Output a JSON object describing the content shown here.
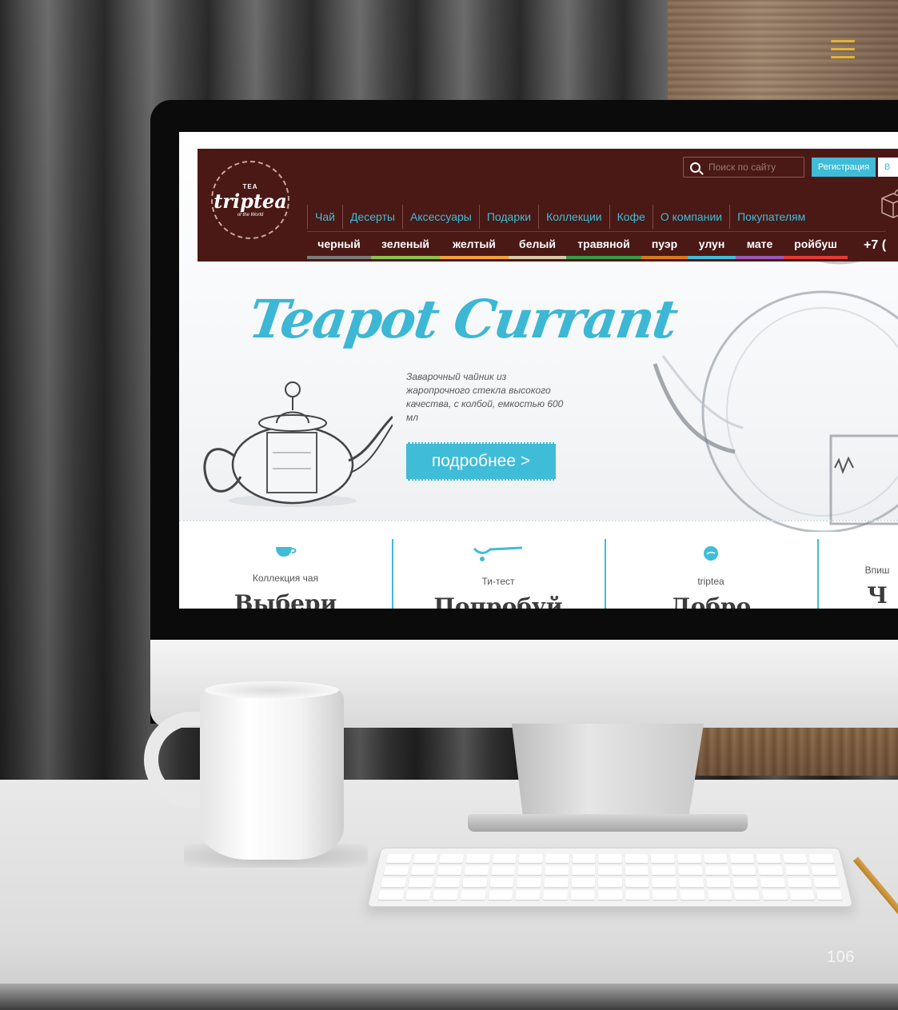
{
  "slide": {
    "page_number": "106",
    "menu_icon": "hamburger-menu-icon"
  },
  "site": {
    "logo": {
      "top": "TEA",
      "name": "triptea",
      "sub": "of the World"
    },
    "search": {
      "placeholder": "Поиск по сайту"
    },
    "register_label": "Регистрация",
    "login_label": "В",
    "main_nav": [
      "Чай",
      "Десерты",
      "Аксессуары",
      "Подарки",
      "Коллекции",
      "Кофе",
      "О компании",
      "Покупателям"
    ],
    "tea_nav": [
      {
        "label": "черный",
        "color": "#7a7a7a"
      },
      {
        "label": "зеленый",
        "color": "#8bc34a"
      },
      {
        "label": "желтый",
        "color": "#f2a23a"
      },
      {
        "label": "белый",
        "color": "#d8c9a8"
      },
      {
        "label": "травяной",
        "color": "#3a9a4a"
      },
      {
        "label": "пуэр",
        "color": "#d97a1a"
      },
      {
        "label": "улун",
        "color": "#3fbcd8"
      },
      {
        "label": "мате",
        "color": "#9b59b6"
      },
      {
        "label": "ройбуш",
        "color": "#e53935"
      }
    ],
    "phone": "+7 (",
    "hero": {
      "title": "Teapot Currant",
      "description": "Заварочный чайник из жаропрочного стекла высокого качества, с колбой, емкостью 600 мл",
      "button": "подробнее >"
    },
    "features": [
      {
        "label": "Коллекция чая",
        "title": "Выбери",
        "icon": "tea-cup-icon"
      },
      {
        "label": "Ти-тест",
        "title": "Попробуй",
        "icon": "spoon-icon"
      },
      {
        "label": "triptea",
        "title": "Добро",
        "icon": "triptea-badge-icon"
      },
      {
        "label": "Впиш",
        "title": "Ч",
        "icon": ""
      }
    ],
    "accent_color": "#3fbcd8",
    "header_color": "#4a1915"
  }
}
